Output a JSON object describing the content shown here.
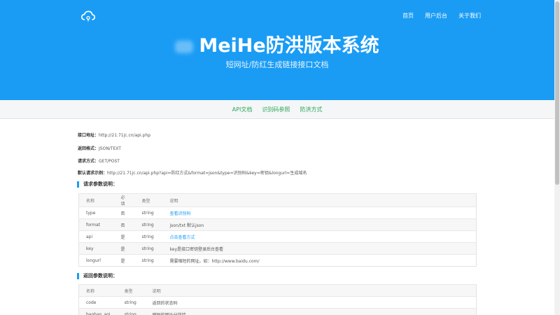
{
  "nav": {
    "items": [
      "首页",
      "用户后台",
      "关于我们"
    ]
  },
  "hero": {
    "title": "MeiHe防洪版本系统",
    "subtitle": "短网址/防红生成链接接口文档"
  },
  "subnav": {
    "items": [
      "API文档",
      "识别码参照",
      "防洪方式"
    ]
  },
  "info": [
    {
      "label": "接口地址：",
      "value": "http://21.71jc.cn/api.php"
    },
    {
      "label": "返回格式：",
      "value": "JSON/TEXT"
    },
    {
      "label": "请求方式：",
      "value": "GET/POST"
    },
    {
      "label": "默认请求示例：",
      "value": "http://21.71jc.cn/api.php?api=防红方式&format=json&type=识别码&key=密钥&longurl=生成域名"
    }
  ],
  "request_params": {
    "title": "请求参数说明：",
    "headers": [
      "名称",
      "必填",
      "类型",
      "说明"
    ],
    "rows": [
      [
        "type",
        "否",
        "string",
        "查看识别码"
      ],
      [
        "format",
        "否",
        "string",
        "json/txt 默认json"
      ],
      [
        "api",
        "是",
        "string",
        "点击查看方式"
      ],
      [
        "key",
        "是",
        "string",
        "key是接口密钥登录后台查看"
      ],
      [
        "longurl",
        "是",
        "string",
        "需要缩短的网址。如：http://www.baidu.com/"
      ]
    ]
  },
  "return_params": {
    "title": "返回参数说明：",
    "headers": [
      "名称",
      "类型",
      "说明"
    ],
    "rows": [
      [
        "code",
        "string",
        "返回的状态码"
      ],
      [
        "baohan_api",
        "string",
        "缩短的网址分链接"
      ]
    ]
  },
  "colors": {
    "brand_blue": "#1a9cf5",
    "link_green": "#2aa65a"
  }
}
